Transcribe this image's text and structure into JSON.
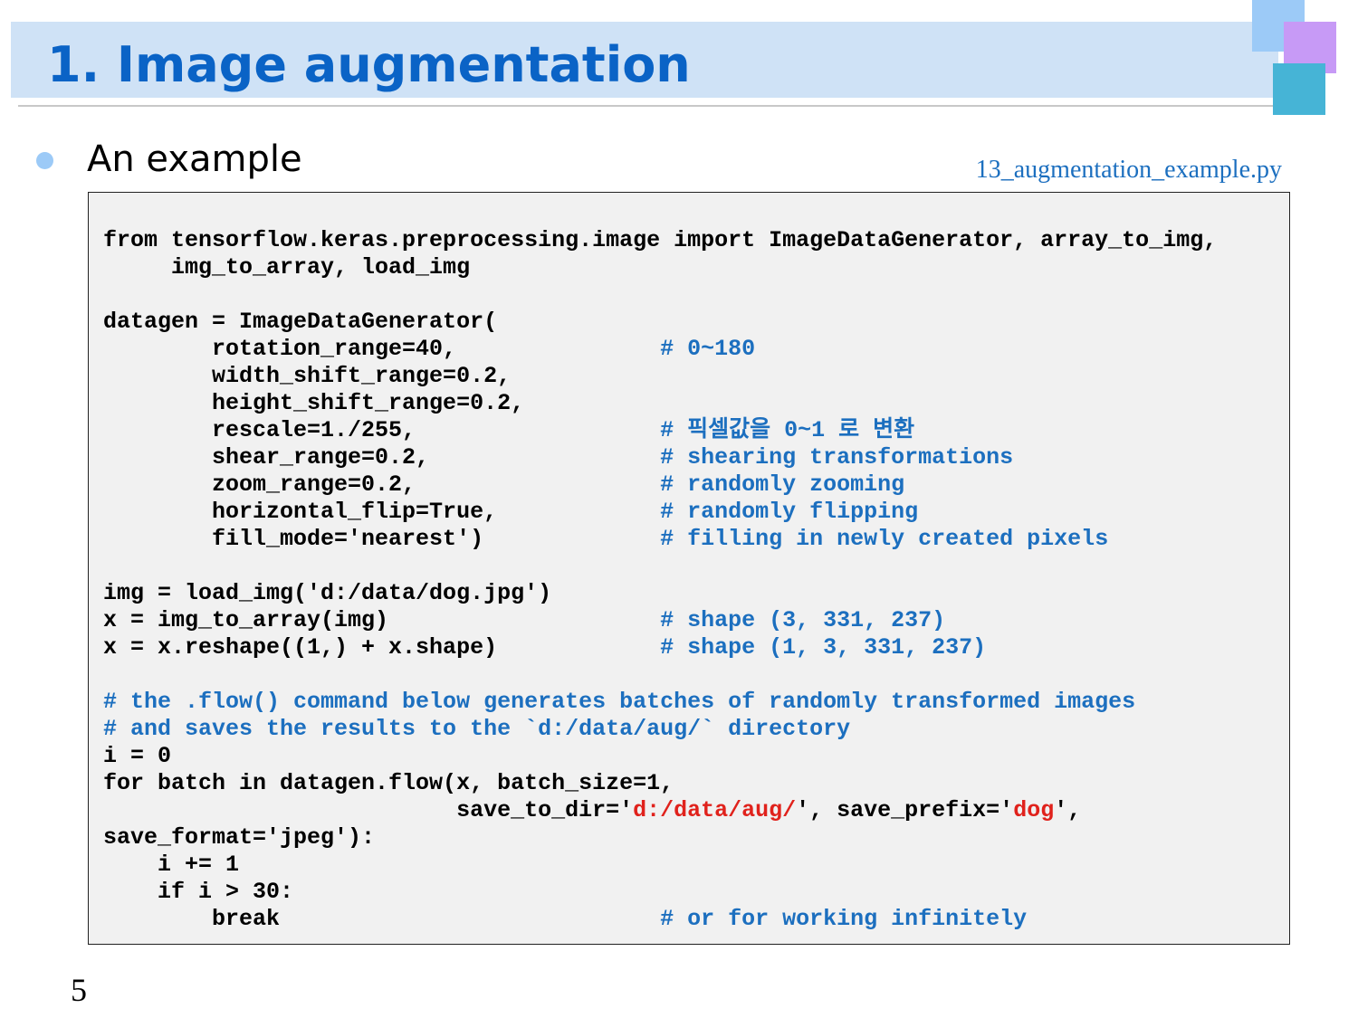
{
  "slide": {
    "title": "1. Image augmentation",
    "bullet": "An example",
    "filename": "13_augmentation_example.py",
    "page_number": "5"
  },
  "colors": {
    "title_text": "#0a63c6",
    "title_band": "#cfe2f6",
    "comment": "#1c6fbf",
    "string_highlight": "#e0221c",
    "code_background": "#f1f1f1"
  },
  "code_lines": [
    [
      {
        "t": "from tensorflow.keras.preprocessing.image import ImageDataGenerator, array_to_img,",
        "c": ""
      }
    ],
    [
      {
        "t": "     img_to_array, load_img",
        "c": ""
      }
    ],
    [],
    [
      {
        "t": "datagen = ImageDataGenerator(",
        "c": ""
      }
    ],
    [
      {
        "t": "        rotation_range=40,",
        "c": ""
      },
      {
        "t": "               # 0~180",
        "c": "c"
      }
    ],
    [
      {
        "t": "        width_shift_range=0.2,",
        "c": ""
      }
    ],
    [
      {
        "t": "        height_shift_range=0.2,",
        "c": ""
      }
    ],
    [
      {
        "t": "        rescale=1./255,",
        "c": ""
      },
      {
        "t": "                  # 픽셀값을 0~1 로 변환",
        "c": "c"
      }
    ],
    [
      {
        "t": "        shear_range=0.2,",
        "c": ""
      },
      {
        "t": "                 # shearing transformations",
        "c": "c"
      }
    ],
    [
      {
        "t": "        zoom_range=0.2,",
        "c": ""
      },
      {
        "t": "                  # randomly zooming",
        "c": "c"
      }
    ],
    [
      {
        "t": "        horizontal_flip=True,",
        "c": ""
      },
      {
        "t": "            # randomly flipping",
        "c": "c"
      }
    ],
    [
      {
        "t": "        fill_mode='nearest')",
        "c": ""
      },
      {
        "t": "             # filling in newly created pixels",
        "c": "c"
      }
    ],
    [],
    [
      {
        "t": "img = load_img('d:/data/dog.jpg')",
        "c": ""
      }
    ],
    [
      {
        "t": "x = img_to_array(img)",
        "c": ""
      },
      {
        "t": "                    # shape (3, 331, 237)",
        "c": "c"
      }
    ],
    [
      {
        "t": "x = x.reshape((1,) + x.shape)",
        "c": ""
      },
      {
        "t": "            # shape (1, 3, 331, 237)",
        "c": "c"
      }
    ],
    [],
    [
      {
        "t": "# the .flow() command below generates batches of randomly transformed images",
        "c": "c"
      }
    ],
    [
      {
        "t": "# and saves the results to the `d:/data/aug/` directory",
        "c": "c"
      }
    ],
    [
      {
        "t": "i = 0",
        "c": ""
      }
    ],
    [
      {
        "t": "for batch in datagen.flow(x, batch_size=1,",
        "c": ""
      }
    ],
    [
      {
        "t": "                          save_to_dir='",
        "c": ""
      },
      {
        "t": "d:/data/aug/",
        "c": "s"
      },
      {
        "t": "', save_prefix='",
        "c": ""
      },
      {
        "t": "dog",
        "c": "s"
      },
      {
        "t": "',",
        "c": ""
      }
    ],
    [
      {
        "t": "save_format='jpeg'):",
        "c": ""
      }
    ],
    [
      {
        "t": "    i += 1",
        "c": ""
      }
    ],
    [
      {
        "t": "    if i > 30:",
        "c": ""
      }
    ],
    [
      {
        "t": "        break",
        "c": ""
      },
      {
        "t": "                            # or for working infinitely",
        "c": "c"
      }
    ]
  ]
}
